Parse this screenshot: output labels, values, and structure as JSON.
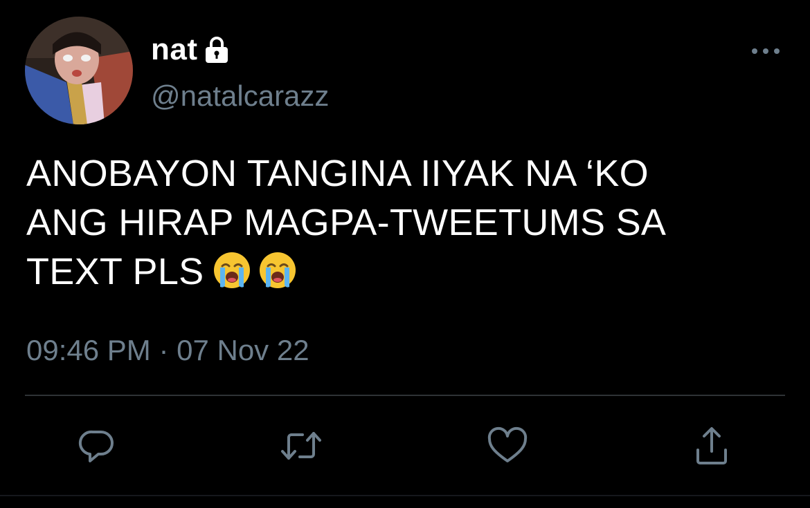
{
  "user": {
    "display_name": "nat",
    "handle": "@natalcarazz",
    "protected": true,
    "avatar_icon": "avatar-photo"
  },
  "tweet": {
    "lines": [
      "ANOBAYON TANGINA IIYAK NA ‘KO",
      "ANG HIRAP MAGPA-TWEETUMS SA",
      "TEXT PLS"
    ],
    "emojis": [
      "loudly-crying-face",
      "loudly-crying-face"
    ],
    "timestamp": "09:46 PM · 07 Nov 22"
  },
  "actions": {
    "reply_icon": "reply-icon",
    "retweet_icon": "retweet-icon",
    "like_icon": "heart-icon",
    "share_icon": "share-icon"
  },
  "colors": {
    "background": "#000000",
    "text": "#ffffff",
    "secondary": "#6e7f8d",
    "divider": "#2f3336"
  }
}
